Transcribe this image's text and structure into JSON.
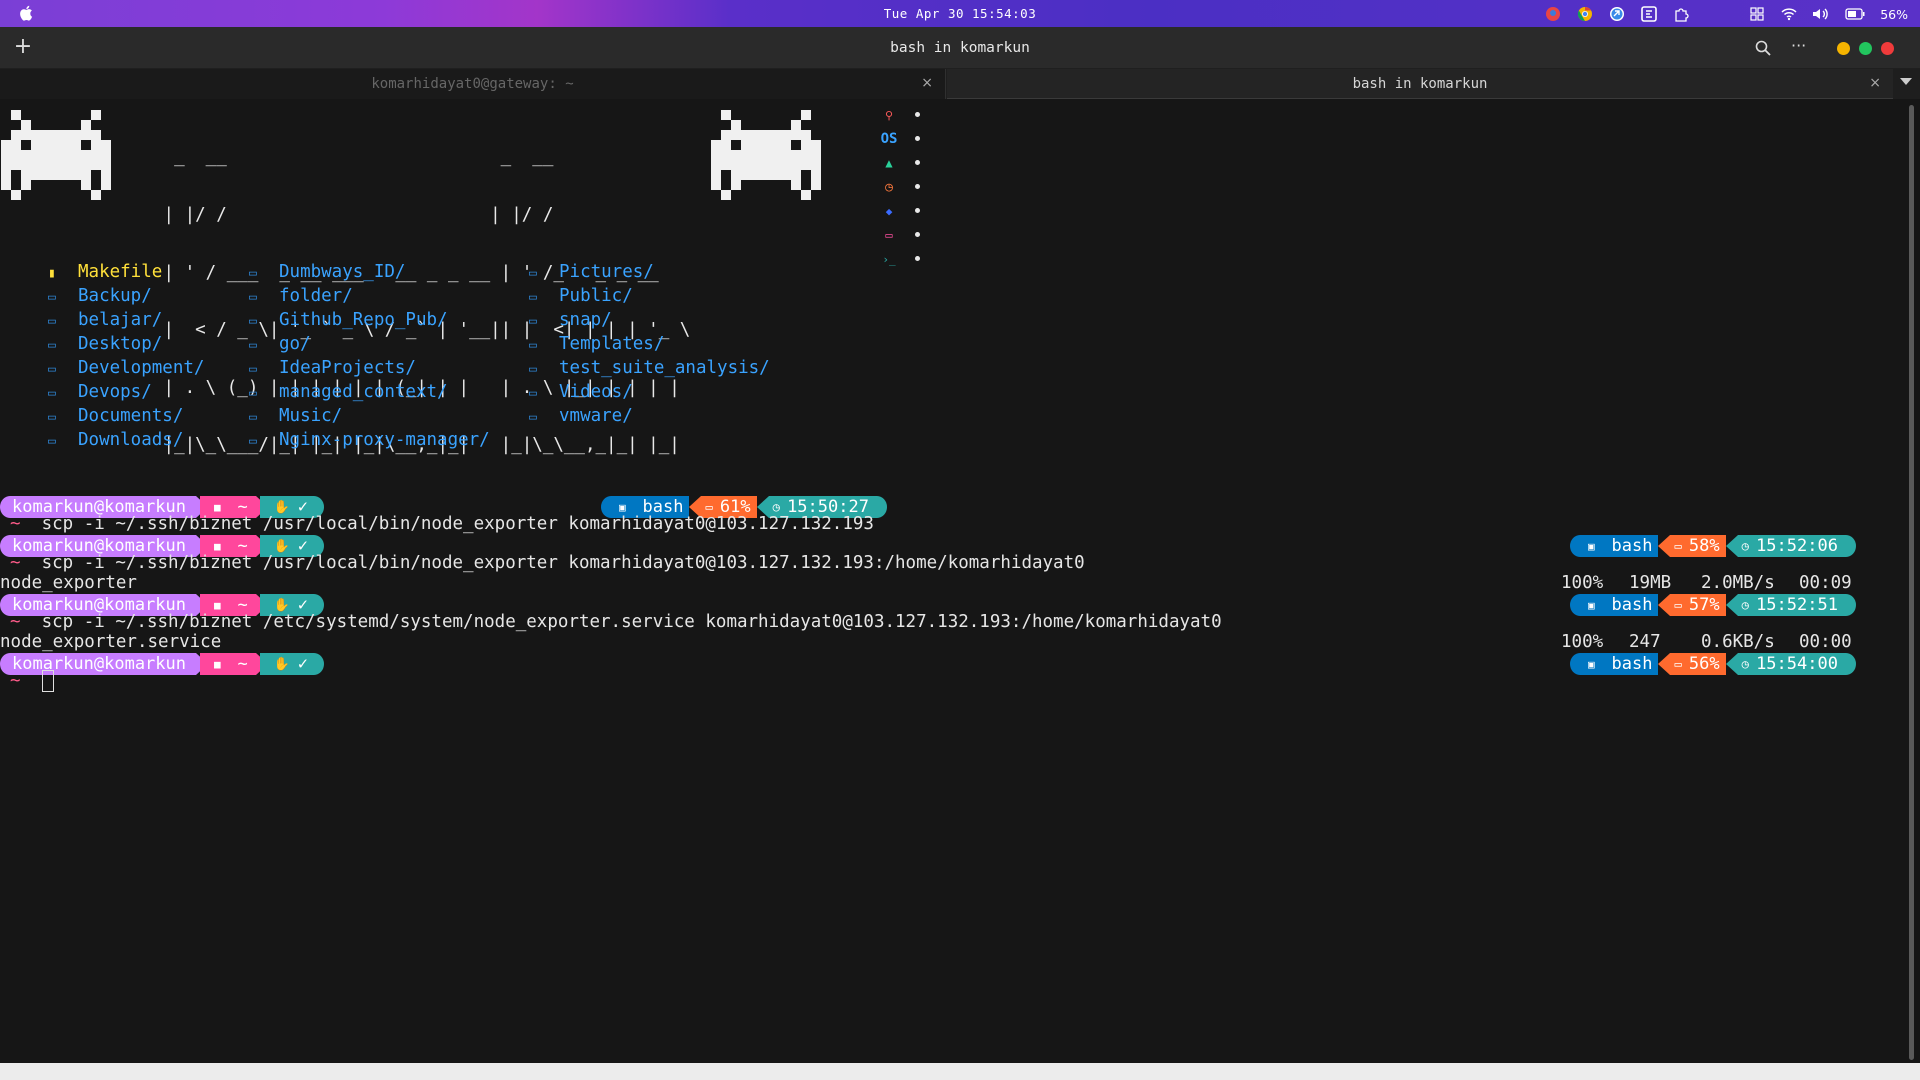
{
  "menubar": {
    "clock": "Tue Apr 30 15:54:03",
    "battery": "56%",
    "tray_icons": [
      "avatar-icon",
      "chrome-icon",
      "app-icon",
      "focus-icon",
      "extension-icon",
      "grid-icon",
      "wifi-icon",
      "volume-icon",
      "battery-icon"
    ]
  },
  "window": {
    "title": "bash in komarkun",
    "new_tab": "+",
    "more": "···"
  },
  "tabs": [
    {
      "label": "komarhidayat0@gateway: ~",
      "close": "×"
    },
    {
      "label": "bash in komarkun",
      "close": "×"
    }
  ],
  "ascii_art": {
    "lines": [
      "  _  __                          _  __",
      " | |/ /                         | |/ /",
      " | ' / ___  _ __ ___   __ _ _ __ | ' /_   _ _ __",
      " |  < / _ \\| '_ ` _ \\ / _` | '__|| |  <| | | | '_ \\",
      " | . \\ (_) | | | | | | (_| | |   | . \\ |_| | | | |",
      " |_|\\_\\___/|_| |_| |_|\\__,_|_|   |_|\\_\\__,_|_| |_|"
    ],
    "os_label": "OS"
  },
  "listing": [
    [
      {
        "name": "Makefile",
        "type": "file"
      },
      {
        "name": "Backup/",
        "type": "dir"
      },
      {
        "name": "belajar/",
        "type": "dir"
      },
      {
        "name": "Desktop/",
        "type": "dir"
      },
      {
        "name": "Development/",
        "type": "dir"
      },
      {
        "name": "Devops/",
        "type": "dir"
      },
      {
        "name": "Documents/",
        "type": "dir"
      },
      {
        "name": "Downloads/",
        "type": "dir"
      }
    ],
    [
      {
        "name": "Dumbways_ID/",
        "type": "dir"
      },
      {
        "name": "folder/",
        "type": "dir"
      },
      {
        "name": "Github_Repo_Pub/",
        "type": "dir"
      },
      {
        "name": "go/",
        "type": "dir"
      },
      {
        "name": "IdeaProjects/",
        "type": "dir"
      },
      {
        "name": "managed_context/",
        "type": "dir"
      },
      {
        "name": "Music/",
        "type": "dir"
      },
      {
        "name": "Nginx-proxy-manager/",
        "type": "dir"
      }
    ],
    [
      {
        "name": "Pictures/",
        "type": "dir"
      },
      {
        "name": "Public/",
        "type": "dir"
      },
      {
        "name": "snap/",
        "type": "dir"
      },
      {
        "name": "Templates/",
        "type": "dir"
      },
      {
        "name": "test_suite_analysis/",
        "type": "dir"
      },
      {
        "name": "Videos/",
        "type": "dir"
      },
      {
        "name": "vmware/",
        "type": "dir"
      }
    ]
  ],
  "prompt": {
    "user": "komarkun@komarkun",
    "dir": "~",
    "status": "✓",
    "shell": "bash",
    "tilde": "~"
  },
  "sessions": [
    {
      "battery": "61%",
      "time": "15:50:27",
      "command": "scp -i ~/.ssh/biznet /usr/local/bin/node_exporter komarhidayat0@103.127.132.193",
      "output": null
    },
    {
      "battery": "58%",
      "time": "15:52:06",
      "command": "scp -i ~/.ssh/biznet /usr/local/bin/node_exporter komarhidayat0@103.127.132.193:/home/komarhidayat0",
      "output": {
        "file": "node_exporter",
        "percent": "100%",
        "size": "19MB",
        "rate": "2.0MB/s",
        "eta": "00:09"
      }
    },
    {
      "battery": "57%",
      "time": "15:52:51",
      "command": "scp -i ~/.ssh/biznet /etc/systemd/system/node_exporter.service komarhidayat0@103.127.132.193:/home/komarhidayat0",
      "output": {
        "file": "node_exporter.service",
        "percent": "100%",
        "size": "247",
        "rate": "0.6KB/s",
        "eta": "00:00"
      }
    },
    {
      "battery": "56%",
      "time": "15:54:00",
      "command": "",
      "output": null
    }
  ],
  "colors": {
    "user_seg": "#c77dff",
    "dir_seg": "#ff479c",
    "status_seg": "#2aa9a5",
    "shell_seg": "#0077c2",
    "battery_seg": "#ff6a2e",
    "time_seg": "#2aa9a5",
    "dir_text": "#3aa3ff",
    "file_text": "#ffe03a"
  }
}
